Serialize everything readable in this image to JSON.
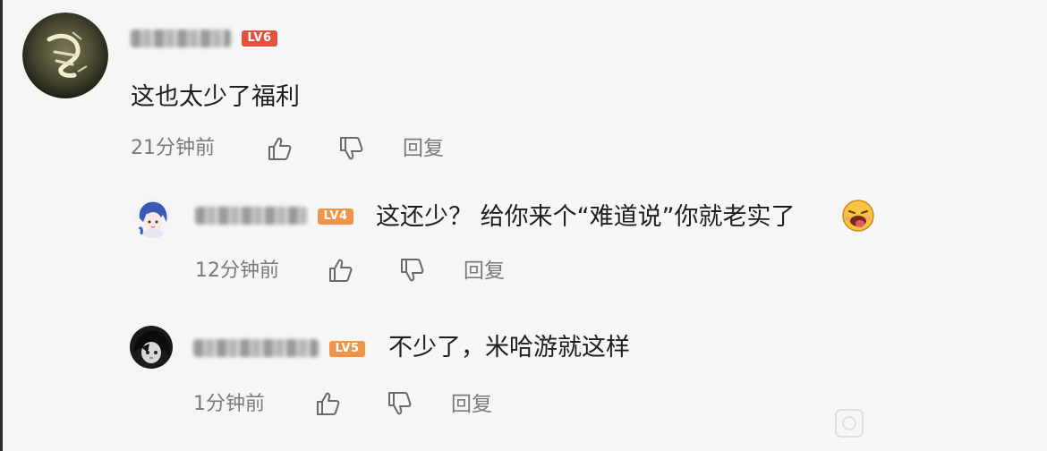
{
  "comments": [
    {
      "level_badge": "LV6",
      "text": "这也太少了福利",
      "time": "21分钟前",
      "reply_label": "回复"
    }
  ],
  "replies": [
    {
      "level_badge": "LV4",
      "text": "这还少？ 给你来个“难道说”你就老实了",
      "emoji": "face-with-tongue-emoji",
      "time": "12分钟前",
      "reply_label": "回复"
    },
    {
      "level_badge": "LV5",
      "text": "不少了，米哈游就这样",
      "time": "1分钟前",
      "reply_label": "回复"
    }
  ],
  "icons": {
    "like": "thumbs-up-icon",
    "dislike": "thumbs-down-icon"
  },
  "colors": {
    "lv6": "#e0523d",
    "lv4": "#f0944a",
    "lv5": "#f0944a",
    "meta_text": "#7a7a7a",
    "background": "#f6f6f6"
  }
}
